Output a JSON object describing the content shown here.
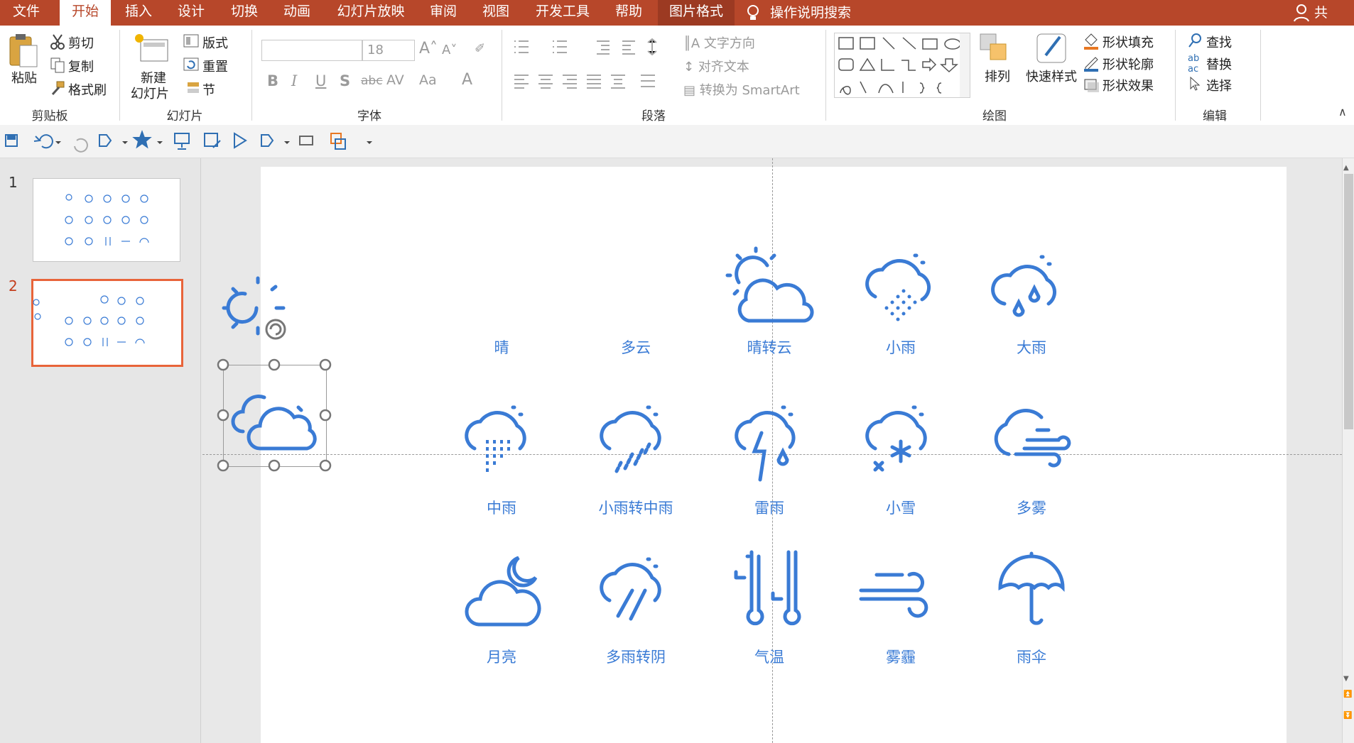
{
  "tabs": [
    "文件",
    "开始",
    "插入",
    "设计",
    "切换",
    "动画",
    "幻灯片放映",
    "审阅",
    "视图",
    "开发工具",
    "帮助",
    "图片格式"
  ],
  "search_tab": "操作说明搜索",
  "share": "共享",
  "clipboard": {
    "paste": "粘贴",
    "cut": "剪切",
    "copy": "复制",
    "format_painter": "格式刷",
    "label": "剪贴板"
  },
  "slides_group": {
    "new_slide": "新建",
    "new_slide2": "幻灯片",
    "layout": "版式",
    "reset": "重置",
    "section": "节",
    "label": "幻灯片"
  },
  "font": {
    "size": "18",
    "label": "字体"
  },
  "paragraph": {
    "text_direction": "文字方向",
    "align_text": "对齐文本",
    "smartart": "转换为 SmartArt",
    "label": "段落"
  },
  "drawing": {
    "arrange": "排列",
    "quick_styles": "快速样式",
    "fill": "形状填充",
    "outline": "形状轮廓",
    "effects": "形状效果",
    "label": "绘图"
  },
  "editing": {
    "find": "查找",
    "replace": "替换",
    "select": "选择",
    "label": "编辑"
  },
  "thumbs": {
    "one": "1",
    "two": "2"
  },
  "icons": [
    "晴",
    "多云",
    "晴转云",
    "小雨",
    "大雨",
    "中雨",
    "小雨转中雨",
    "雷雨",
    "小雪",
    "多雾",
    "月亮",
    "多雨转阴",
    "气温",
    "雾霾",
    "雨伞"
  ],
  "colors": {
    "accent": "#3a7bd5",
    "ribbon": "#b7472a"
  }
}
